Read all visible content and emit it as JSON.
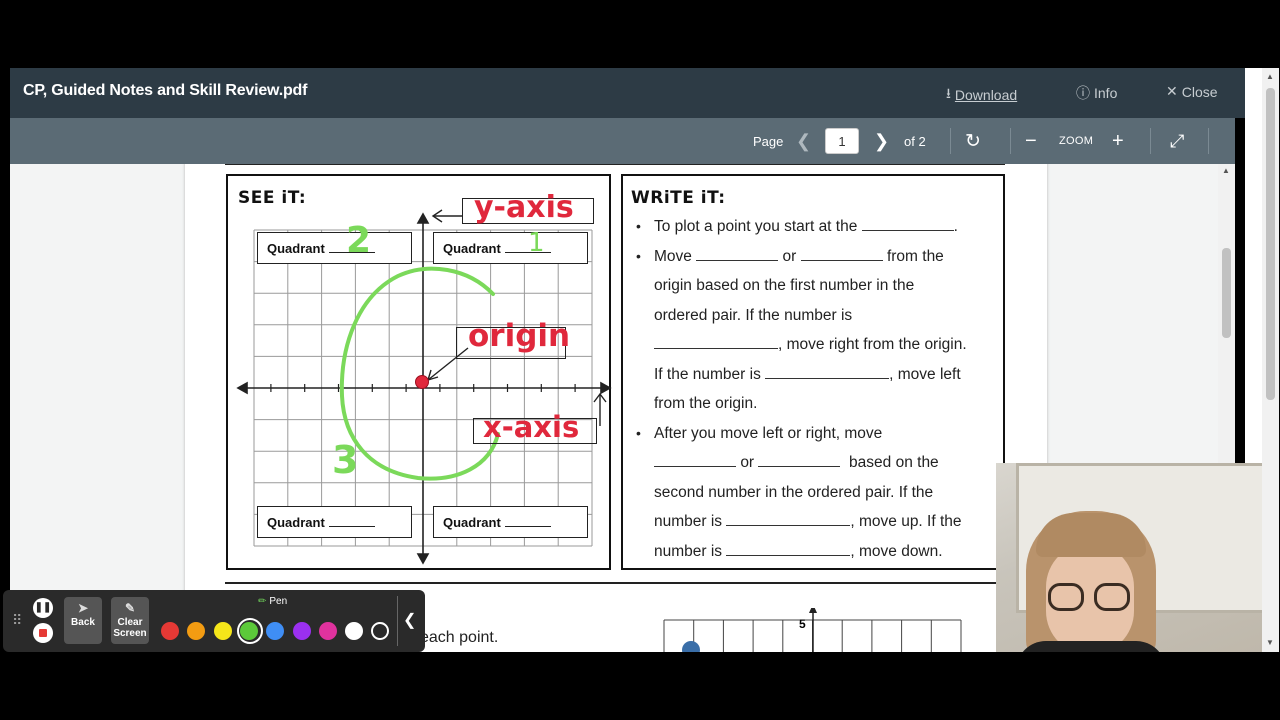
{
  "viewer": {
    "title": "CP, Guided Notes and Skill Review.pdf",
    "download_label": "Download",
    "info_label": "Info",
    "close_label": "Close"
  },
  "toolbar": {
    "page_label": "Page",
    "page_value": "1",
    "page_of": "of 2",
    "zoom_label": "ZOOM"
  },
  "icons": {
    "download": "download-icon",
    "info": "info-icon",
    "close": "close-icon",
    "prev": "chevron-left-icon",
    "next": "chevron-right-icon",
    "rotate": "rotate-icon",
    "zoom_out": "minus-icon",
    "zoom_in": "plus-icon",
    "fullscreen": "fullscreen-icon"
  },
  "see_it": {
    "heading": "SEE iT:",
    "quadrant_label": "Quadrant",
    "handwriting": {
      "y_axis": "y-axis",
      "x_axis": "x-axis",
      "origin": "origin",
      "q2": "2",
      "q1": "1",
      "q3": "3"
    }
  },
  "write_it": {
    "heading": "WRiTE iT:",
    "bullet1": {
      "a": "To plot a point you start at the",
      "b": "."
    },
    "bullet2": {
      "a": "Move",
      "b": "or",
      "c": "from the",
      "d": "origin based on the first number in the",
      "e": "ordered pair. If the number is",
      "f": ", move right from the origin.",
      "g": "If the number is",
      "h": ", move left",
      "i": "from the origin."
    },
    "bullet3": {
      "a": "After you move left or right, move",
      "b": "or",
      "c": "based on the",
      "d": "second number in the ordered pair. If the",
      "e": "number is",
      "f": ", move up. If the",
      "g": "number is",
      "h": ", move down."
    }
  },
  "bottom": {
    "partial_text": "each point.",
    "grid_label": "5"
  },
  "annotation_bar": {
    "back_label": "Back",
    "clear_label": "Clear Screen",
    "pen_label": "Pen",
    "colors": [
      "#e53935",
      "#f39c12",
      "#f5e61a",
      "#5cc93a",
      "#3f8ef5",
      "#9b30f0",
      "#e0329e",
      "#ffffff",
      "#2a2a2a"
    ],
    "selected_color": "#5cc93a"
  },
  "colors": {
    "header_bg": "#2d3b45",
    "toolbar_bg": "#5b6b75",
    "annotation_red": "#e0283c",
    "annotation_green": "#7bd95a"
  }
}
